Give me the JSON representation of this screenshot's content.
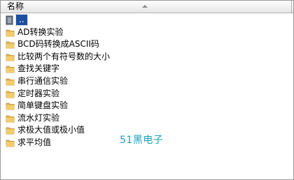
{
  "header": {
    "name_column": "名称"
  },
  "items": [
    {
      "label": "..",
      "type": "up",
      "selected": true
    },
    {
      "label": "AD转换实验",
      "type": "folder"
    },
    {
      "label": "BCD码转换成ASCII码",
      "type": "folder"
    },
    {
      "label": "比较两个有符号数的大小",
      "type": "folder"
    },
    {
      "label": "查找关键字",
      "type": "folder"
    },
    {
      "label": "串行通信实验",
      "type": "folder"
    },
    {
      "label": "定时器实验",
      "type": "folder"
    },
    {
      "label": "简单键盘实验",
      "type": "folder"
    },
    {
      "label": "流水灯实验",
      "type": "folder"
    },
    {
      "label": "求极大值或极小值",
      "type": "folder"
    },
    {
      "label": "求平均值",
      "type": "folder"
    }
  ],
  "watermark": "51黑电子",
  "colors": {
    "selection": "#1e4f9e",
    "folder": "#e8b74a",
    "watermark": "#1a9fb4"
  },
  "icons": {
    "up": "folder-up-icon",
    "folder": "folder-icon"
  }
}
